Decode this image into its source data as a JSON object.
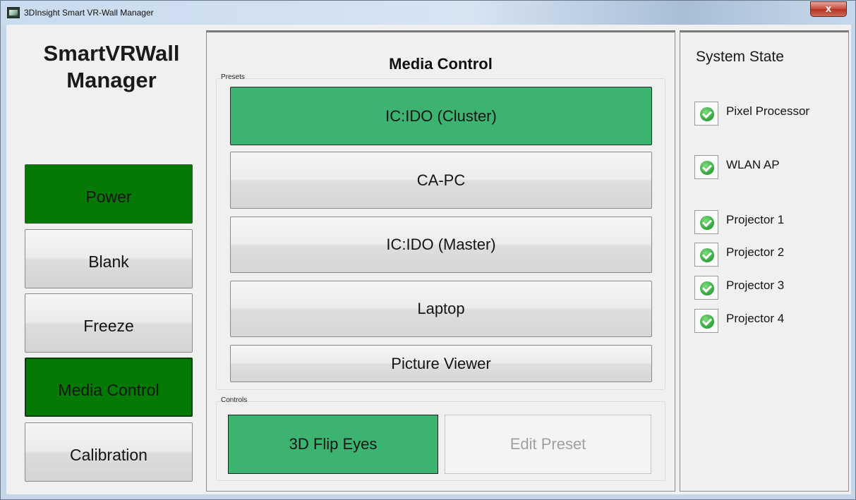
{
  "window": {
    "title": "3DInsight Smart VR-Wall Manager",
    "close_label": "x"
  },
  "sidebar": {
    "app_title_line1": "SmartVRWall",
    "app_title_line2": "Manager",
    "buttons": [
      {
        "label": "Power",
        "state": "on"
      },
      {
        "label": "Blank",
        "state": "off"
      },
      {
        "label": "Freeze",
        "state": "off"
      },
      {
        "label": "Media Control",
        "state": "selected"
      },
      {
        "label": "Calibration",
        "state": "off"
      }
    ]
  },
  "media": {
    "title": "Media Control",
    "presets_label": "Presets",
    "presets": [
      {
        "label": "IC:IDO (Cluster)",
        "selected": true
      },
      {
        "label": "CA-PC",
        "selected": false
      },
      {
        "label": "IC:IDO (Master)",
        "selected": false
      },
      {
        "label": "Laptop",
        "selected": false
      },
      {
        "label": "Picture Viewer",
        "selected": false
      }
    ],
    "controls_label": "Controls",
    "flip_label": "3D Flip Eyes",
    "edit_label": "Edit Preset"
  },
  "system_state": {
    "title": "System State",
    "items": [
      {
        "label": "Pixel Processor",
        "status": "ok"
      },
      {
        "label": "WLAN AP",
        "status": "ok"
      },
      {
        "label": "Projector 1",
        "status": "ok"
      },
      {
        "label": "Projector 2",
        "status": "ok"
      },
      {
        "label": "Projector 3",
        "status": "ok"
      },
      {
        "label": "Projector 4",
        "status": "ok"
      }
    ]
  },
  "colors": {
    "active_green": "#047a04",
    "selected_green": "#3cb371",
    "disabled_text": "#a0a0a0"
  }
}
